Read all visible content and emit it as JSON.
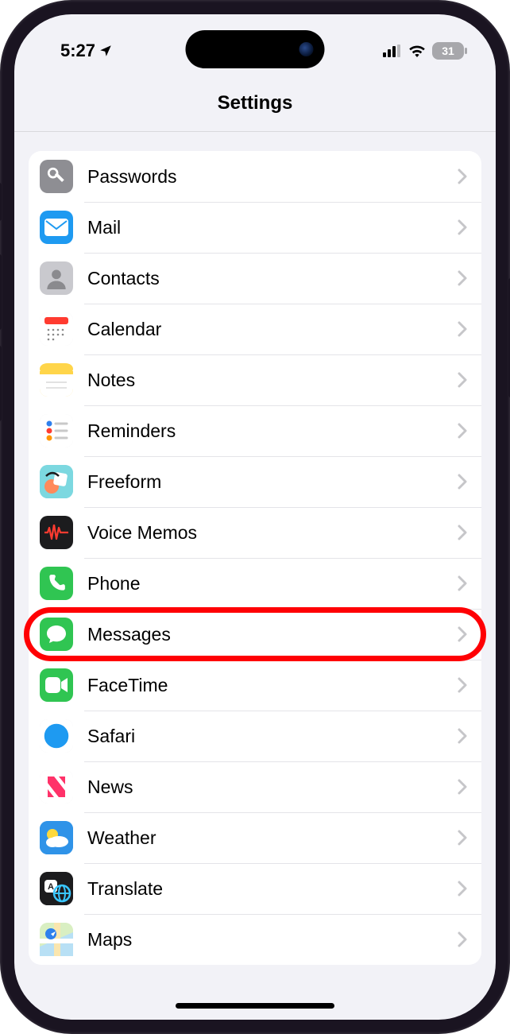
{
  "status": {
    "time": "5:27",
    "battery": "31"
  },
  "header": {
    "title": "Settings"
  },
  "items": [
    {
      "id": "passwords",
      "label": "Passwords",
      "icon": "key",
      "bg": "#8e8e93"
    },
    {
      "id": "mail",
      "label": "Mail",
      "icon": "envelope",
      "bg": "#1e9af1"
    },
    {
      "id": "contacts",
      "label": "Contacts",
      "icon": "person",
      "bg": "#c9c9ce"
    },
    {
      "id": "calendar",
      "label": "Calendar",
      "icon": "calendar",
      "bg": "#ffffff"
    },
    {
      "id": "notes",
      "label": "Notes",
      "icon": "notes",
      "bg": "#ffd54a"
    },
    {
      "id": "reminders",
      "label": "Reminders",
      "icon": "reminders",
      "bg": "#ffffff"
    },
    {
      "id": "freeform",
      "label": "Freeform",
      "icon": "freeform",
      "bg": "#7cd8e0"
    },
    {
      "id": "voicememos",
      "label": "Voice Memos",
      "icon": "wave",
      "bg": "#1c1c1e"
    },
    {
      "id": "phone",
      "label": "Phone",
      "icon": "phone",
      "bg": "#30c552"
    },
    {
      "id": "messages",
      "label": "Messages",
      "icon": "bubble",
      "bg": "#30c552",
      "highlighted": true
    },
    {
      "id": "facetime",
      "label": "FaceTime",
      "icon": "video",
      "bg": "#30c552"
    },
    {
      "id": "safari",
      "label": "Safari",
      "icon": "safari",
      "bg": "#ffffff"
    },
    {
      "id": "news",
      "label": "News",
      "icon": "news",
      "bg": "#ffffff"
    },
    {
      "id": "weather",
      "label": "Weather",
      "icon": "weather",
      "bg": "#2f93e8"
    },
    {
      "id": "translate",
      "label": "Translate",
      "icon": "translate",
      "bg": "#1c1c1e"
    },
    {
      "id": "maps",
      "label": "Maps",
      "icon": "maps",
      "bg": "#d9efc2"
    }
  ]
}
